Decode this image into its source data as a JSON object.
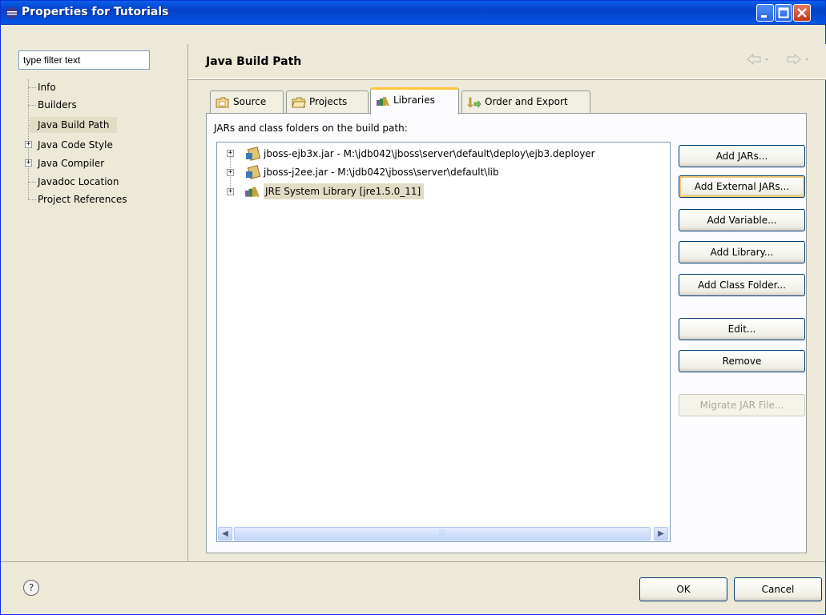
{
  "window": {
    "title": "Properties for Tutorials"
  },
  "filter": {
    "placeholder": "type filter text",
    "value": "type filter text"
  },
  "tree": {
    "items": [
      {
        "label": "Info",
        "expandable": false
      },
      {
        "label": "Builders",
        "expandable": false
      },
      {
        "label": "Java Build Path",
        "expandable": false,
        "selected": true
      },
      {
        "label": "Java Code Style",
        "expandable": true
      },
      {
        "label": "Java Compiler",
        "expandable": true
      },
      {
        "label": "Javadoc Location",
        "expandable": false
      },
      {
        "label": "Project References",
        "expandable": false
      }
    ]
  },
  "header": {
    "title": "Java Build Path",
    "back_icon": "back-arrow-icon",
    "forward_icon": "forward-arrow-icon"
  },
  "tabs": [
    {
      "label": "Source",
      "icon": "source-folder-icon"
    },
    {
      "label": "Projects",
      "icon": "project-folder-icon"
    },
    {
      "label": "Libraries",
      "icon": "library-icon",
      "active": true
    },
    {
      "label": "Order and Export",
      "icon": "order-export-icon"
    }
  ],
  "libraries": {
    "label": "JARs and class folders on the build path:",
    "entries": [
      {
        "label": "jboss-ejb3x.jar - M:\\jdb042\\jboss\\server\\default\\deploy\\ejb3.deployer",
        "icon": "jar-icon"
      },
      {
        "label": "jboss-j2ee.jar - M:\\jdb042\\jboss\\server\\default\\lib",
        "icon": "jar-icon"
      },
      {
        "label": "JRE System Library [jre1.5.0_11]",
        "icon": "library-icon",
        "selected": true
      }
    ]
  },
  "buttons": {
    "add_jars": "Add JARs...",
    "add_external_jars": "Add External JARs...",
    "add_variable": "Add Variable...",
    "add_library": "Add Library...",
    "add_class_folder": "Add Class Folder...",
    "edit": "Edit...",
    "remove": "Remove",
    "migrate_jar": "Migrate JAR File..."
  },
  "footer": {
    "help": "?",
    "ok": "OK",
    "cancel": "Cancel"
  },
  "colors": {
    "titlebar": "#0554e4",
    "selection": "#e1dcc6",
    "active_tab_accent": "#ffc83c"
  }
}
